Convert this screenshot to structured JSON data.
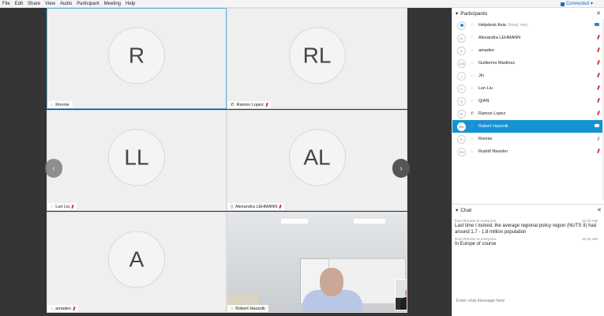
{
  "menu": [
    "File",
    "Edit",
    "Share",
    "View",
    "Audio",
    "Participant",
    "Meeting",
    "Help"
  ],
  "status": {
    "connection": "Connected"
  },
  "tiles": [
    {
      "initials": "R",
      "name": "Ronnie"
    },
    {
      "initials": "RL",
      "name": "Ramon Lopez"
    },
    {
      "initials": "LL",
      "name": "Lun Liu"
    },
    {
      "initials": "AL",
      "name": "Alexandra LEHMANN"
    },
    {
      "initials": "A",
      "name": "amadeo"
    },
    {
      "initials": "",
      "name": "Robert Hasznik"
    }
  ],
  "participants_panel": {
    "title": "Participants",
    "items": [
      {
        "avatar": "",
        "name": "Helpdesk Asia",
        "note": "(Host, me)",
        "status": "camera"
      },
      {
        "avatar": "AL",
        "name": "Alexandra LEHMANN",
        "note": "",
        "status": "muted"
      },
      {
        "avatar": "A",
        "name": "amadeo",
        "note": "",
        "status": "muted"
      },
      {
        "avatar": "GM",
        "name": "Guillermo Martinez",
        "note": "",
        "status": "muted"
      },
      {
        "avatar": "J",
        "name": "Jin",
        "note": "",
        "status": "muted"
      },
      {
        "avatar": "LL",
        "name": "Lun Liu",
        "note": "",
        "status": "muted"
      },
      {
        "avatar": "Q",
        "name": "QIAN",
        "note": "",
        "status": "muted"
      },
      {
        "avatar": "RL",
        "name": "Ramon Lopez",
        "note": "",
        "status": "muted"
      },
      {
        "avatar": "RH",
        "name": "Robert Hasznik",
        "note": "",
        "status": "camera"
      },
      {
        "avatar": "R",
        "name": "Ronnie",
        "note": "",
        "status": "unmuted"
      },
      {
        "avatar": "RN",
        "name": "Rudolf Niessler",
        "note": "",
        "status": "muted"
      }
    ]
  },
  "chat": {
    "title": "Chat",
    "messages": [
      {
        "from": "from Ronnie to everyone",
        "time": "11:02 AM",
        "text": "Last time I looked, the average regional policy region (NUTS II) had around 1.7 - 1.8 million population"
      },
      {
        "from": "from Ronnie to everyone",
        "time": "11:02 AM",
        "text": "In Europe of course"
      }
    ],
    "placeholder": "Enter chat message here"
  },
  "colors": {
    "accent": "#1592d4",
    "stage": "#353535",
    "muted": "#d33333"
  }
}
